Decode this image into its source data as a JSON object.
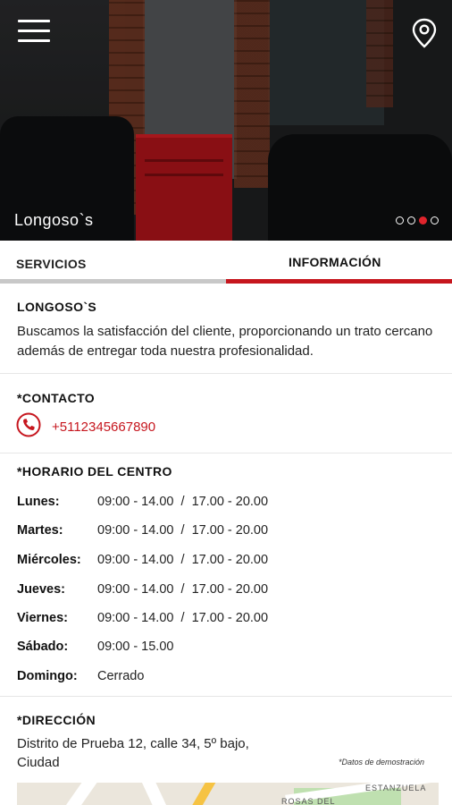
{
  "hero": {
    "title": "Longoso`s",
    "slide_count": 4,
    "active_slide": 3
  },
  "header": {
    "menu_icon": "hamburger-menu-icon",
    "location_icon": "map-pin-icon"
  },
  "tabs": [
    {
      "label": "SERVICIOS",
      "active": false
    },
    {
      "label": "INFORMACIÓN",
      "active": true
    }
  ],
  "about": {
    "title": "LONGOSO`S",
    "description": "Buscamos la satisfacción del cliente, proporcionando un trato cercano además de entregar toda nuestra profesionalidad."
  },
  "contact": {
    "title": "*CONTACTO",
    "phone_icon": "phone-icon",
    "phone": "+5112345667890"
  },
  "hours": {
    "title": "*HORARIO DEL CENTRO",
    "rows": [
      {
        "day": "Lunes:",
        "time": "09:00 - 14.00  /  17.00 - 20.00"
      },
      {
        "day": "Martes:",
        "time": "09:00 - 14.00  /  17.00 - 20.00"
      },
      {
        "day": "Miércoles:",
        "time": "09:00 - 14.00  /  17.00 - 20.00"
      },
      {
        "day": "Jueves:",
        "time": "09:00 - 14.00  /  17.00 - 20.00"
      },
      {
        "day": "Viernes:",
        "time": "09:00 - 14.00  /  17.00 - 20.00"
      },
      {
        "day": "Sábado:",
        "time": "09:00 - 15.00"
      },
      {
        "day": "Domingo:",
        "time": "Cerrado"
      }
    ]
  },
  "address": {
    "title": "*DIRECCIÓN",
    "line1": "Distrito de Prueba 12, calle 34, 5º bajo,",
    "line2": "Ciudad",
    "demo_note": "*Datos de demostración",
    "map_labels": [
      "ESTANZUELA",
      "ROSAS DEL"
    ]
  },
  "colors": {
    "accent": "#c6161e",
    "tab_inactive_bar": "#c8c8c8"
  }
}
